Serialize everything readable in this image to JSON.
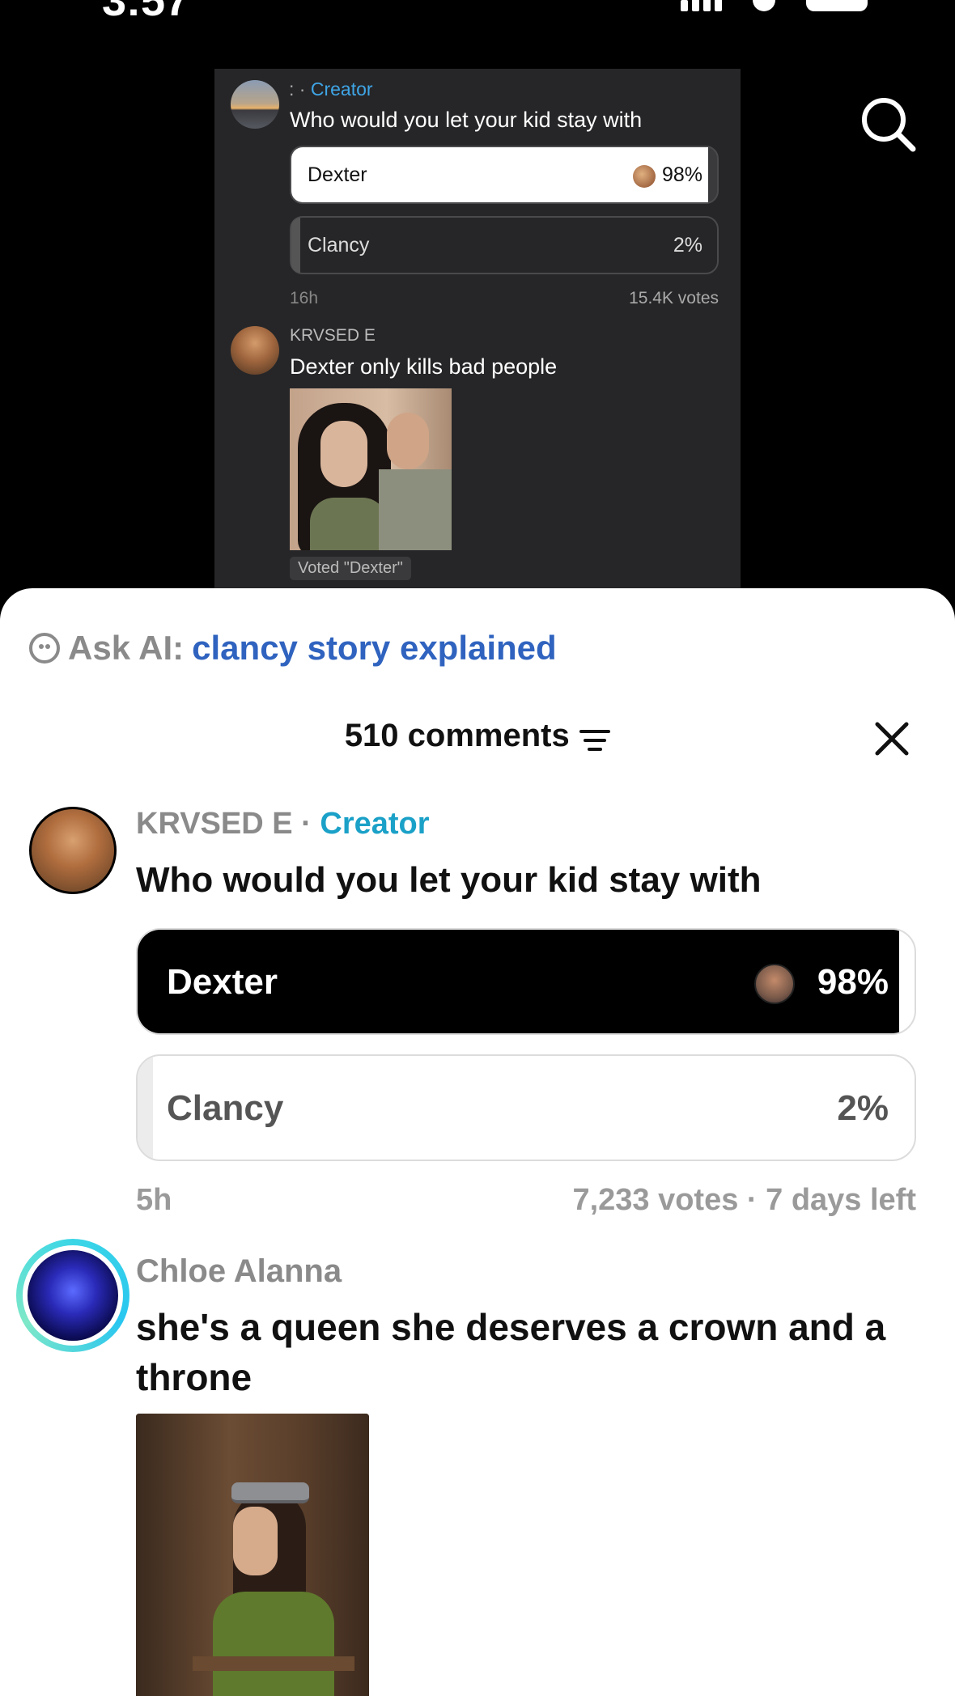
{
  "status": {
    "time": "3:57"
  },
  "colors": {
    "creator_blue": "#1ba1c8",
    "ask_ai_blue": "#2f63bf",
    "poll_bar": "#000000"
  },
  "icons": {
    "search": "search-icon",
    "close": "close-icon",
    "filter": "filter-icon",
    "ai": "ai-face-icon"
  },
  "screenshot": {
    "meta_separator": ": ·",
    "creator_badge": "Creator",
    "question": "Who would you let your kid stay with",
    "options": [
      {
        "label": "Dexter",
        "percent": "98%",
        "share": 0.98
      },
      {
        "label": "Clancy",
        "percent": "2%",
        "share": 0.02
      }
    ],
    "time": "16h",
    "votes": "15.4K votes",
    "comment_user": "KRVSED E",
    "comment_text": "Dexter only kills bad people",
    "voted_badge": "Voted \"Dexter\""
  },
  "sheet": {
    "ask_ai_label": "Ask AI:",
    "ask_ai_query": "clancy story explained",
    "comments_count": "510 comments",
    "poll": {
      "author": "KRVSED E",
      "separator": "·",
      "creator_badge": "Creator",
      "question": "Who would you let your kid stay with",
      "options": [
        {
          "label": "Dexter",
          "percent": "98%",
          "share": 0.98
        },
        {
          "label": "Clancy",
          "percent": "2%",
          "share": 0.02
        }
      ],
      "time": "5h",
      "meta": "7,233 votes · 7 days left"
    },
    "comment": {
      "author": "Chloe Alanna",
      "text": "she's a queen she deserves a crown and a throne"
    }
  }
}
